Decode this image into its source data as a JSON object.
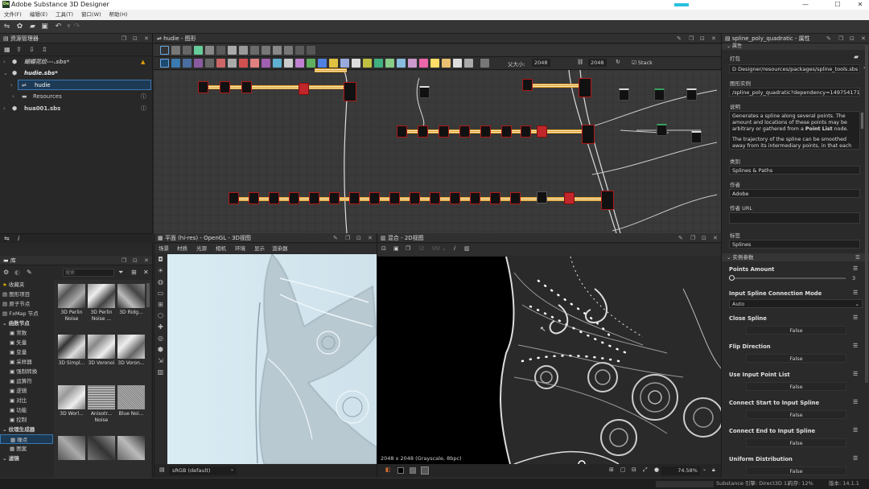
{
  "window": {
    "title": "Adobe Substance 3D Designer",
    "logo": "De"
  },
  "menu": [
    "文件(F)",
    "编辑(E)",
    "工具(T)",
    "窗口(W)",
    "帮助(H)"
  ],
  "explorer": {
    "title": "资源管理器",
    "items": [
      {
        "label": "蝴蝶花纹---.sbs*"
      },
      {
        "label": "hudie.sbs*"
      },
      {
        "label": "hudie"
      },
      {
        "label": "Resources"
      },
      {
        "label": "hua001.sbs"
      }
    ]
  },
  "graph": {
    "title": "hudie - 图形",
    "parent_size_label": "父大小:",
    "size1": "2048",
    "size2": "2048",
    "stack_label": "Stack"
  },
  "library": {
    "title": "库",
    "search_placeholder": "搜索",
    "categories": [
      "收藏夹",
      "图形项目",
      "原子节点",
      "FxMap 节点",
      "函数节点",
      "常数",
      "矢量",
      "变量",
      "采样器",
      "强制转换",
      "运算符",
      "逻辑",
      "对比",
      "功能",
      "控制",
      "纹理生成器",
      "噪点",
      "图案",
      "滤镜"
    ],
    "thumbs": [
      {
        "label": "3D Perlin Noise"
      },
      {
        "label": "3D Perlin Noise ..."
      },
      {
        "label": "3D Ridg..."
      },
      {
        "label": "3D Simpl..."
      },
      {
        "label": "3D Voronoi"
      },
      {
        "label": "3D Voron..."
      },
      {
        "label": "3D Worl..."
      },
      {
        "label": "Anisotr... Noise"
      },
      {
        "label": "Blue Noi..."
      }
    ]
  },
  "view3d": {
    "title": "平面 (hi-res) - OpenGL - 3D视图",
    "menu": [
      "场景",
      "材质",
      "光源",
      "相机",
      "环境",
      "显示",
      "渲染器"
    ],
    "colorspace": "sRGB (default)"
  },
  "view2d": {
    "title": "混合 - 2D视图",
    "uv_label": "UV",
    "info": "2048 x 2048 (Grayscale, 8bpc)",
    "zoom": "74.58%"
  },
  "props": {
    "title": "spline_poly_quadratic - 属性",
    "section_attr": "属性",
    "package_label": "打包",
    "package_value": "D Designer/resources/packages/spline_tools.sbs",
    "instance_label": "图形实例",
    "instance_value": "/spline_poly_quadratic?dependency=1497541716",
    "desc_label": "说明",
    "desc_text1": "Generates a spline along several points. The amount and locations of these points may be arbitrary or gathered from a ",
    "desc_bold": "Point List",
    "desc_text2": " node.",
    "desc_text3": "The trajectory of the spline can be smoothed away from its intermediary points, in that each",
    "category_label": "类别",
    "category_value": "Splines & Paths",
    "author_label": "作者",
    "author_value": "Adobe",
    "authorurl_label": "作者 URL",
    "authorurl_value": "",
    "tags_label": "标签",
    "tags_value": "Splines",
    "section_params": "实例参数",
    "params": [
      {
        "name": "Points Amount",
        "value": "3",
        "slider": 0.0
      },
      {
        "name": "Input Spline Connection Mode",
        "value": "Auto"
      },
      {
        "name": "Close Spline",
        "value": "False"
      },
      {
        "name": "Flip Direction",
        "value": "False"
      },
      {
        "name": "Use Input Point List",
        "value": "False"
      },
      {
        "name": "Connect Start to Input Spline",
        "value": "False"
      },
      {
        "name": "Connect End to Input Spline",
        "value": "False"
      },
      {
        "name": "Uniform Distribution",
        "value": "False"
      }
    ]
  },
  "status": {
    "engine": "Substance 引擎: Direct3D 11",
    "memory": "内存: 12%",
    "version_label": "版本: 14.1.1"
  },
  "colors": {
    "accent": "#1a8fd6",
    "node_red": "#c0262a",
    "wire": "#e3a020"
  }
}
